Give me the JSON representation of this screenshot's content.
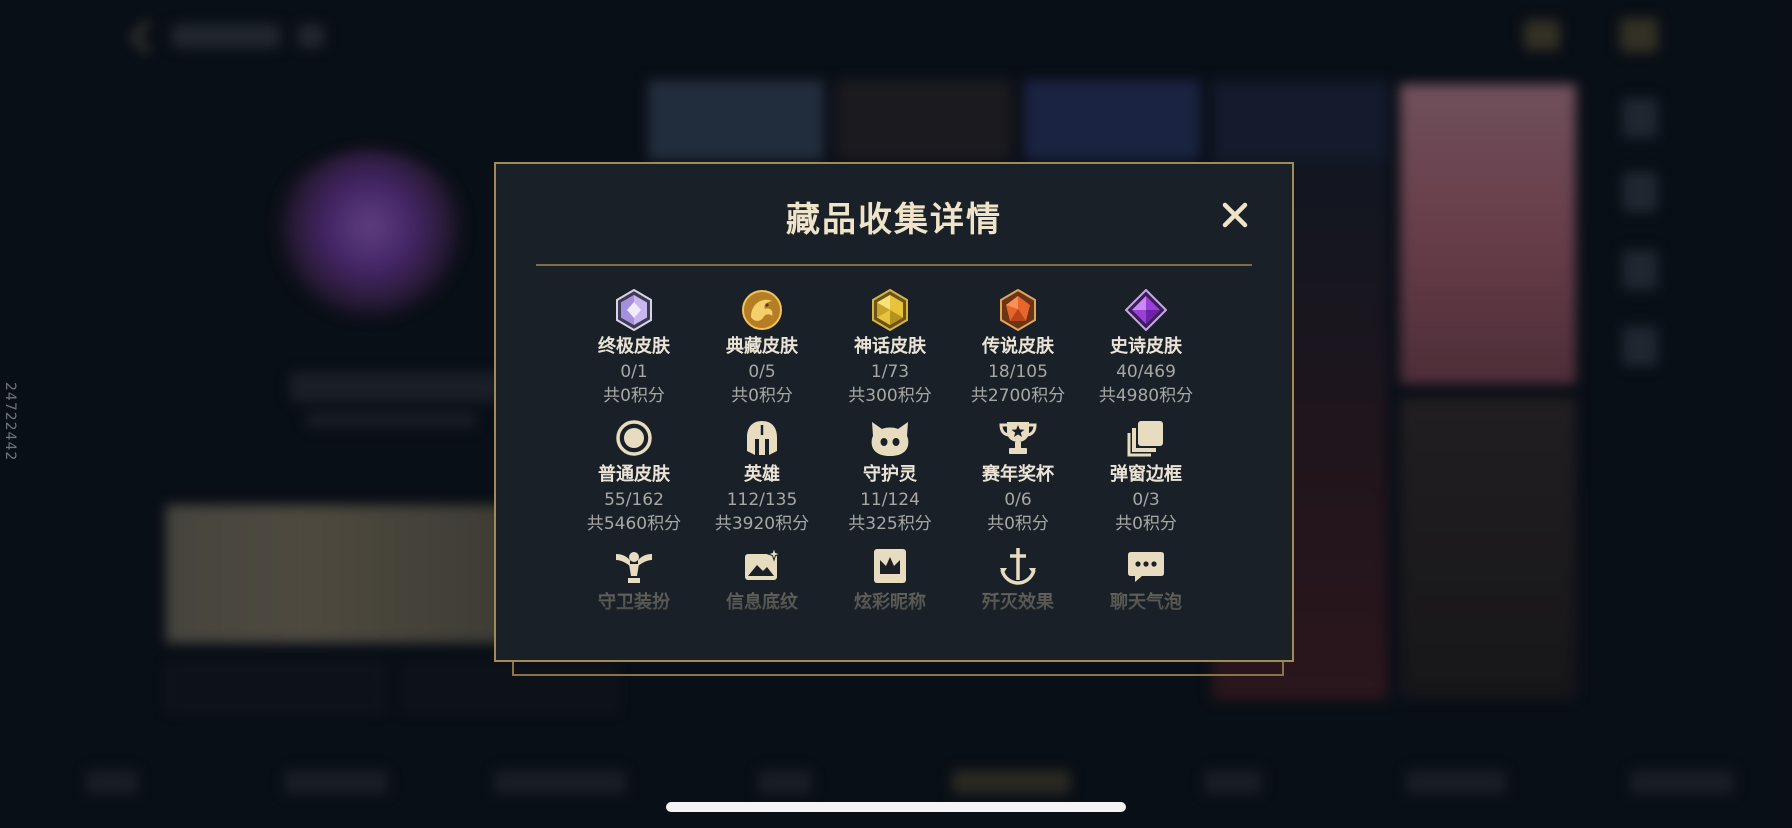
{
  "modal": {
    "title": "藏品收集详情",
    "close_label": "✕"
  },
  "side_label": "24722442",
  "categories": [
    [
      {
        "name": "终极皮肤",
        "count": "0/1",
        "points": "共0积分",
        "icon": "ultimate-gem-icon"
      },
      {
        "name": "典藏皮肤",
        "count": "0/5",
        "points": "共0积分",
        "icon": "dragon-emblem-icon"
      },
      {
        "name": "神话皮肤",
        "count": "1/73",
        "points": "共300积分",
        "icon": "mythic-gem-icon"
      },
      {
        "name": "传说皮肤",
        "count": "18/105",
        "points": "共2700积分",
        "icon": "legendary-gem-icon"
      },
      {
        "name": "史诗皮肤",
        "count": "40/469",
        "points": "共4980积分",
        "icon": "epic-gem-icon"
      }
    ],
    [
      {
        "name": "普通皮肤",
        "count": "55/162",
        "points": "共5460积分",
        "icon": "ring-icon"
      },
      {
        "name": "英雄",
        "count": "112/135",
        "points": "共3920积分",
        "icon": "helmet-icon"
      },
      {
        "name": "守护灵",
        "count": "11/124",
        "points": "共325积分",
        "icon": "pet-icon"
      },
      {
        "name": "赛年奖杯",
        "count": "0/6",
        "points": "共0积分",
        "icon": "trophy-icon"
      },
      {
        "name": "弹窗边框",
        "count": "0/3",
        "points": "共0积分",
        "icon": "frame-icon"
      }
    ],
    [
      {
        "name": "守卫装扮",
        "icon": "ward-icon"
      },
      {
        "name": "信息底纹",
        "icon": "banner-image-icon"
      },
      {
        "name": "炫彩昵称",
        "icon": "crown-card-icon"
      },
      {
        "name": "歼灭效果",
        "icon": "anchor-icon"
      },
      {
        "name": "聊天气泡",
        "icon": "chat-bubble-icon"
      }
    ]
  ],
  "colors": {
    "title": "#efe3c9",
    "border": "#a28a55",
    "panel": "#1a2027",
    "icon_beige": "#e7dcc0"
  }
}
